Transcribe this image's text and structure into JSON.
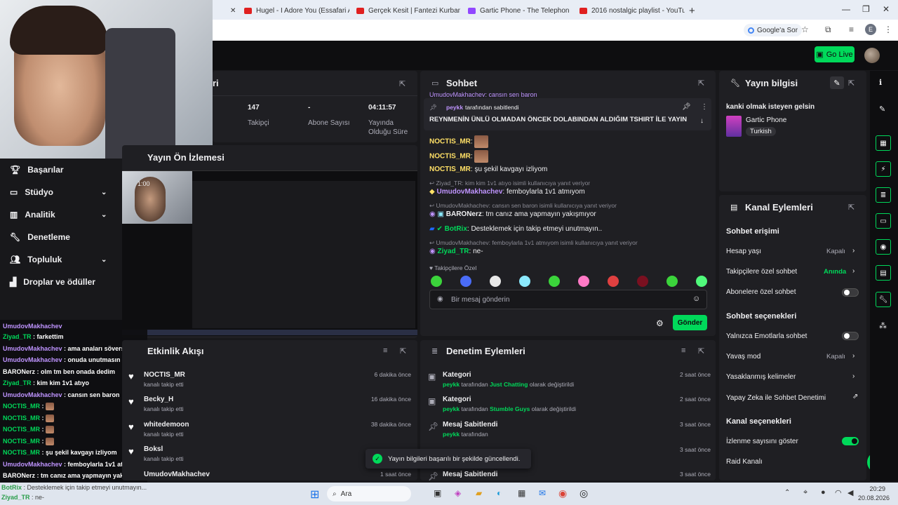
{
  "browser": {
    "tabs": [
      {
        "title": "Hugel - I Adore You (Essafari Afr..."
      },
      {
        "title": "Gerçek Kesit | Fantezi Kurbanı..."
      },
      {
        "title": "Gartic Phone - The Telephone G..."
      },
      {
        "title": "2016 nostalgic playlist - YouTub..."
      }
    ],
    "google_button": "Google'a Sor",
    "profile_letter": "E"
  },
  "topnav": {
    "go_live": "Go Live"
  },
  "sidebar": {
    "items": [
      {
        "label": "Başarılar",
        "icon": "trophy-icon"
      },
      {
        "label": "Stüdyo",
        "icon": "studio-icon"
      },
      {
        "label": "Analitik",
        "icon": "chart-icon"
      },
      {
        "label": "Denetleme",
        "icon": "wrench-icon"
      },
      {
        "label": "Topluluk",
        "icon": "people-icon"
      },
      {
        "label": "Droplar ve ödüller",
        "icon": "gift-icon"
      }
    ]
  },
  "stats": {
    "followers_value": "147",
    "followers_label": "Takipçi",
    "subs_value": "-",
    "subs_label": "Abone Sayısı",
    "uptime_value": "04:11:57",
    "uptime_label": "Yayında Olduğu Süre",
    "title_fragment": "ri"
  },
  "preview": {
    "title": "Yayın Ön İzlemesi",
    "timer": "1:00"
  },
  "left_chat": [
    {
      "user": "UmudovMakhachev",
      "text": "farkettim",
      "color": "purple"
    },
    {
      "user": "Ziyad_TR",
      "text": "farkettim",
      "color": "green"
    },
    {
      "user": "UmudovMakhachev",
      "text": "ama anaları söverse babasınıda bı koyarsında",
      "color": "purple"
    },
    {
      "user": "UmudovMakhachev",
      "text": "onuda unutmasın",
      "color": "purple"
    },
    {
      "user": "BARONerz",
      "text": "olm tm ben onada dedim",
      "color": "white"
    },
    {
      "user": "Ziyad_TR",
      "text": "kim kim 1v1 atıyo",
      "color": "green"
    },
    {
      "user": "UmudovMakhachev",
      "text": "cansın sen baron",
      "color": "purple"
    },
    {
      "user": "NOCTIS_MR",
      "text": "",
      "color": "green"
    },
    {
      "user": "NOCTIS_MR",
      "text": "",
      "color": "green"
    },
    {
      "user": "NOCTIS_MR",
      "text": "",
      "color": "green"
    },
    {
      "user": "NOCTIS_MR",
      "text": "",
      "color": "green"
    },
    {
      "user": "NOCTIS_MR",
      "text": "şu şekil kavgayı izliyom",
      "color": "green"
    },
    {
      "user": "UmudovMakhachev",
      "text": "femboylarla 1v1 atmıyom",
      "color": "purple"
    },
    {
      "user": "BARONerz",
      "text": "tm canız ama yapmayın yakışmıyor",
      "color": "white"
    },
    {
      "user": "BotRix",
      "text": "Desteklemek için takip etmeyi unutmayın..",
      "color": "green"
    },
    {
      "user": "Ziyad_TR",
      "text": "ne-",
      "color": "green"
    }
  ],
  "activity": {
    "title": "Etkinlik Akışı",
    "items": [
      {
        "name": "NOCTIS_MR",
        "action": "kanalı takip etti",
        "time": "6 dakika önce"
      },
      {
        "name": "Becky_H",
        "action": "kanalı takip etti",
        "time": "16 dakika önce"
      },
      {
        "name": "whitedemoon",
        "action": "kanalı takip etti",
        "time": "38 dakika önce"
      },
      {
        "name": "Boksl",
        "action": "kanalı takip etti",
        "time": ""
      },
      {
        "name": "UmudovMakhachev",
        "action": "",
        "time": "1 saat önce"
      }
    ]
  },
  "chat": {
    "title": "Sohbet",
    "top_cut": "UmudovMakhachev: cansın sen baron",
    "pinned_by": "peykk",
    "pinned_label": "tarafından sabitlendi",
    "pinned_text": "REYNMENİN ÜNLÜ OLMADAN ÖNCEK DOLABINDAN ALDIĞIM TSHIRT İLE YAYIN",
    "messages": [
      {
        "user": "NOCTIS_MR",
        "text": ""
      },
      {
        "user": "NOCTIS_MR",
        "text": ""
      },
      {
        "user": "NOCTIS_MR",
        "text": "şu şekil kavgayı izliyom"
      },
      {
        "reply": "Ziyad_TR: kim kim 1v1 atıyo isimli kullanıcıya yanıt veriyor"
      },
      {
        "user": "UmudovMakhachev",
        "text": "femboylarla 1v1 atmıyom"
      },
      {
        "reply": "UmudovMakhachev: cansın sen baron isimli kullanıcıya yanıt veriyor"
      },
      {
        "user": "BARONerz",
        "text": "tm canız ama yapmayın yakışmıyor"
      },
      {
        "user": "BotRix",
        "text": "Desteklemek için takip etmeyi unutmayın.."
      },
      {
        "reply": "UmudovMakhachev: femboylarla 1v1 atmıyom isimli kullanıcıya yanıt veriyor"
      },
      {
        "user": "Ziyad_TR",
        "text": "ne-"
      }
    ],
    "followers_only": "Takipçilere Özel",
    "input_placeholder": "Bir mesaj gönderin",
    "send": "Gönder"
  },
  "moderation": {
    "title": "Denetim Eylemleri",
    "items": [
      {
        "title": "Kategori",
        "by": "peykk",
        "mid": "tarafından",
        "value": "Just Chatting",
        "tail": "olarak değiştirildi",
        "time": "2 saat önce"
      },
      {
        "title": "Kategori",
        "by": "peykk",
        "mid": "tarafından",
        "value": "Stumble Guys",
        "tail": "olarak değiştirildi",
        "time": "2 saat önce"
      },
      {
        "title": "Mesaj Sabitlendi",
        "by": "peykk",
        "mid": "tarafından",
        "value": "",
        "tail": "",
        "time": "3 saat önce"
      },
      {
        "title": "",
        "by": "",
        "mid": "",
        "value": "",
        "tail": "",
        "time": "3 saat önce"
      },
      {
        "title": "Mesaj Sabitlendi",
        "by": "",
        "mid": "",
        "value": "",
        "tail": "",
        "time": "3 saat önce"
      }
    ]
  },
  "toast": "Yayın bilgileri başarılı bir şekilde güncellendi.",
  "stream_info": {
    "title": "Yayın bilgisi",
    "stream_title": "kanki olmak isteyen gelsin",
    "category": "Gartic Phone",
    "tag": "Turkish"
  },
  "channel_actions": {
    "title": "Kanal Eylemleri",
    "chat_access": "Sohbet erişimi",
    "account_age": "Hesap yaşı",
    "account_age_val": "Kapalı",
    "followers_chat": "Takipçilere özel sohbet",
    "followers_chat_val": "Anında",
    "subs_chat": "Abonelere özel sohbet",
    "chat_options": "Sohbet seçenekleri",
    "emote_only": "Yalnızca Emotlarla sohbet",
    "slow_mode": "Yavaş mod",
    "slow_mode_val": "Kapalı",
    "banned_words": "Yasaklanmış kelimeler",
    "ai_mod": "Yapay Zeka ile Sohbet Denetimi",
    "channel_options": "Kanal seçenekleri",
    "view_count": "İzlenme sayısını göster",
    "raid": "Raid Kanalı"
  },
  "taskbar": {
    "search": "Ara",
    "time": "20:29",
    "date": "20.08.2026",
    "tray_user": "BotRix",
    "tray_text": "Desteklemek için takip etmeyi unutmayın...",
    "tray_user2": "Ziyad_TR",
    "tray_text2": "ne-"
  },
  "colors": {
    "accent": "#00d95a",
    "purple": "#bf94ff",
    "bg": "#18181b",
    "panel": "#1f1f23"
  }
}
